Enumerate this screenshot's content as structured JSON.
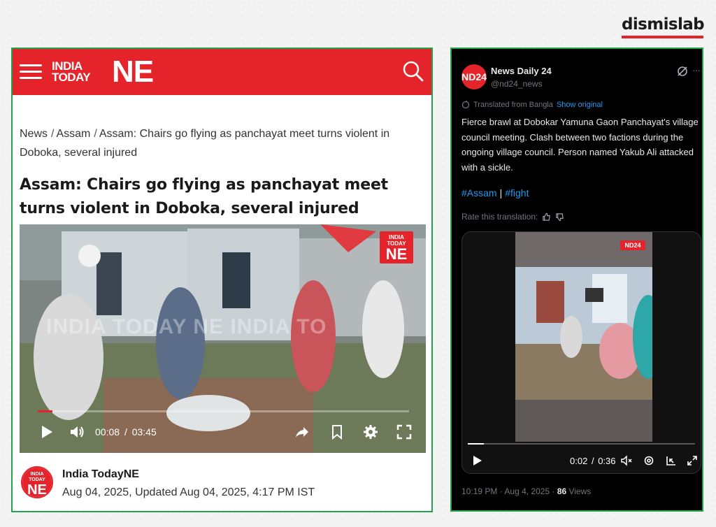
{
  "brand": {
    "logo_text": "dismislab",
    "accent_color": "#e3222a",
    "panel_border_color": "#21a24c"
  },
  "article": {
    "site_logo_small": "INDIA TODAY",
    "site_logo_big": "NE",
    "breadcrumb": [
      "News",
      "Assam",
      "Assam: Chairs go flying as panchayat meet turns violent in Doboka, several injured"
    ],
    "headline": "Assam: Chairs go flying as panchayat meet turns violent in Doboka, several injured",
    "video": {
      "badge_small": "INDIA TODAY",
      "badge_big": "NE",
      "watermark": "INDIA TODAY NE   INDIA TO",
      "current_time": "00:08",
      "time_sep": "/",
      "duration": "03:45",
      "progress": 0.04
    },
    "author": {
      "avatar_small": "INDIA TODAY",
      "avatar_big": "NE",
      "name": "India TodayNE",
      "date": "Aug 04, 2025, Updated Aug 04, 2025, 4:17 PM IST"
    },
    "icons": [
      "menu-icon",
      "search-icon",
      "play-icon",
      "volume-icon",
      "share-icon",
      "bookmark-icon",
      "settings-icon",
      "fullscreen-icon"
    ]
  },
  "tweet": {
    "avatar_text": "ND24",
    "name": "News Daily 24",
    "handle": "@nd24_news",
    "translated_label": "Translated from Bangla",
    "show_original": "Show original",
    "text": "Fierce brawl at Dobokar Yamuna Gaon Panchayat's village council meeting. Clash between two factions during the ongoing village council. Person named Yakub Ali attacked with a sickle.",
    "tags": [
      "#Assam",
      "#fight"
    ],
    "tag_sep": "|",
    "rate_label": "Rate this translation:",
    "video": {
      "badge": "ND24",
      "current_time": "0:02",
      "time_sep": "/",
      "duration": "0:36",
      "progress": 0.07
    },
    "time": "10:19 PM",
    "dot": "·",
    "date": "Aug 4, 2025",
    "views_count": "86",
    "views_label": "Views"
  }
}
